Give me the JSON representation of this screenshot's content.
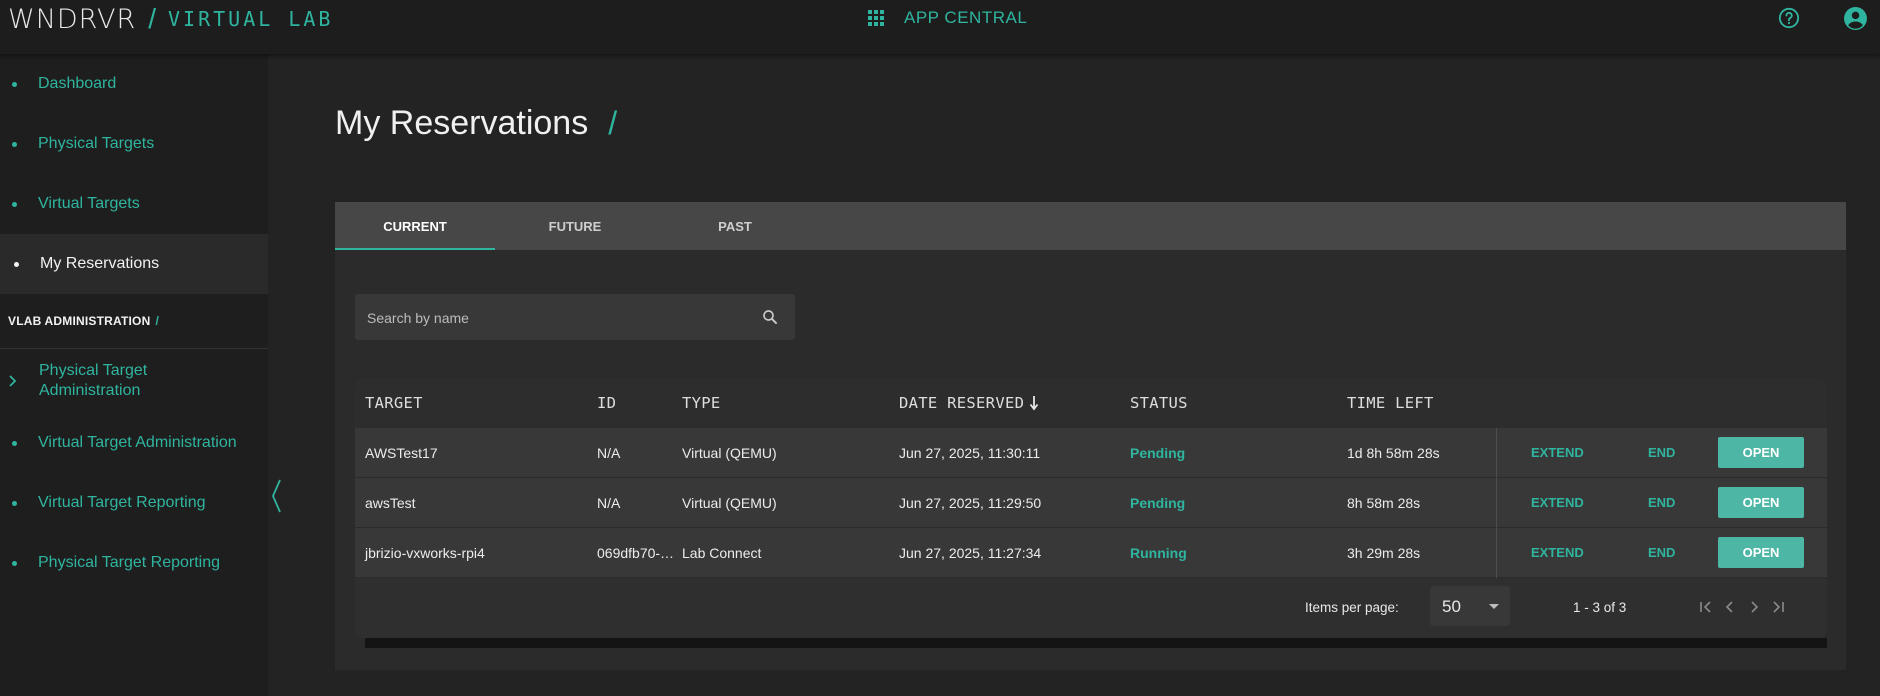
{
  "brand": {
    "logo": "WNDRVR",
    "slash": "/",
    "subtitle": "VIRTUAL LAB"
  },
  "top_nav": {
    "app_central": "APP CENTRAL",
    "icons": [
      "apps-grid-icon",
      "help-icon",
      "account-circle-icon"
    ]
  },
  "sidebar": {
    "items": [
      {
        "label": "Dashboard"
      },
      {
        "label": "Physical Targets"
      },
      {
        "label": "Virtual Targets"
      },
      {
        "label": "My Reservations",
        "active": true
      }
    ],
    "admin_header": "VLAB ADMINISTRATION",
    "admin_header_slash": "/",
    "admin_items": [
      {
        "label": "Physical Target Administration",
        "expandable": true
      },
      {
        "label": "Virtual Target Administration"
      },
      {
        "label": "Virtual Target Reporting"
      },
      {
        "label": "Physical Target Reporting"
      }
    ]
  },
  "page": {
    "title": "My Reservations",
    "title_slash": "/"
  },
  "tabs": [
    {
      "label": "CURRENT",
      "active": true
    },
    {
      "label": "FUTURE"
    },
    {
      "label": "PAST"
    }
  ],
  "search": {
    "placeholder": "Search by name",
    "value": ""
  },
  "table": {
    "columns": [
      "TARGET",
      "ID",
      "TYPE",
      "DATE RESERVED",
      "STATUS",
      "TIME LEFT"
    ],
    "sort_column": "DATE RESERVED",
    "sort_direction": "descending",
    "rows": [
      {
        "target": "AWSTest17",
        "id": "N/A",
        "type": "Virtual (QEMU)",
        "date_reserved": "Jun 27, 2025, 11:30:11",
        "status": "Pending",
        "time_left": "1d 8h 58m 28s",
        "extend": "EXTEND",
        "end": "END",
        "open": "OPEN"
      },
      {
        "target": "awsTest",
        "id": "N/A",
        "type": "Virtual (QEMU)",
        "date_reserved": "Jun 27, 2025, 11:29:50",
        "status": "Pending",
        "time_left": "8h 58m 28s",
        "extend": "EXTEND",
        "end": "END",
        "open": "OPEN"
      },
      {
        "target": "jbrizio-vxworks-rpi4",
        "id": "069dfb70-…",
        "type": "Lab Connect",
        "date_reserved": "Jun 27, 2025, 11:27:34",
        "status": "Running",
        "time_left": "3h 29m 28s",
        "extend": "EXTEND",
        "end": "END",
        "open": "OPEN"
      }
    ]
  },
  "paginator": {
    "items_per_page_label": "Items per page:",
    "items_per_page": "50",
    "range": "1 - 3 of 3"
  },
  "colors": {
    "accent": "#2fb59f",
    "open_button": "#4db6a4",
    "background": "#232323"
  }
}
